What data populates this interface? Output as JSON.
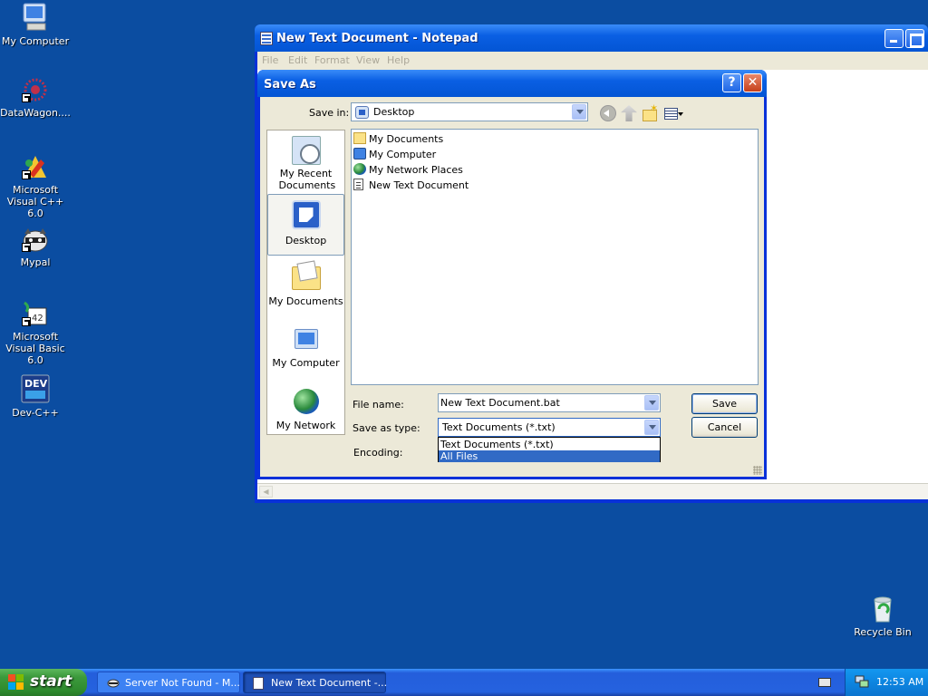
{
  "desktop": {
    "icons": [
      {
        "label": "My Computer",
        "icon": "my-computer-icon"
      },
      {
        "label": "DataWagon....",
        "icon": "datawagon-icon"
      },
      {
        "label": "Microsoft Visual C++ 6.0",
        "icon": "visual-cpp-icon"
      },
      {
        "label": "Mypal",
        "icon": "mypal-icon"
      },
      {
        "label": "Microsoft Visual Basic 6.0",
        "icon": "visual-basic-icon"
      },
      {
        "label": "Dev-C++",
        "icon": "dev-cpp-icon"
      }
    ],
    "recycle_bin": "Recycle Bin",
    "background_color": "#0b4da1"
  },
  "notepad": {
    "title": "New Text Document - Notepad",
    "menu": [
      "File",
      "Edit",
      "Format",
      "View",
      "Help"
    ]
  },
  "save_as": {
    "title": "Save As",
    "help_label": "?",
    "close_label": "✕",
    "save_in_label": "Save in:",
    "save_in_value": "Desktop",
    "places": [
      "My Recent Documents",
      "Desktop",
      "My Documents",
      "My Computer",
      "My Network"
    ],
    "files": [
      {
        "name": "My Documents",
        "icon": "my-documents-icon"
      },
      {
        "name": "My Computer",
        "icon": "my-computer-icon"
      },
      {
        "name": "My Network Places",
        "icon": "network-places-icon"
      },
      {
        "name": "New Text Document",
        "icon": "text-document-icon"
      }
    ],
    "file_name_label": "File name:",
    "file_name_value": "New Text Document.bat",
    "save_type_label": "Save as type:",
    "save_type_value": "Text Documents (*.txt)",
    "type_options": [
      "Text Documents (*.txt)",
      "All Files"
    ],
    "type_highlighted": "All Files",
    "encoding_label": "Encoding:",
    "save_button": "Save",
    "cancel_button": "Cancel"
  },
  "taskbar": {
    "start_label": "start",
    "tasks": [
      {
        "label": "Server Not Found - M...",
        "active": false
      },
      {
        "label": "New Text Document -...",
        "active": true
      }
    ],
    "clock": "12:53 AM"
  }
}
